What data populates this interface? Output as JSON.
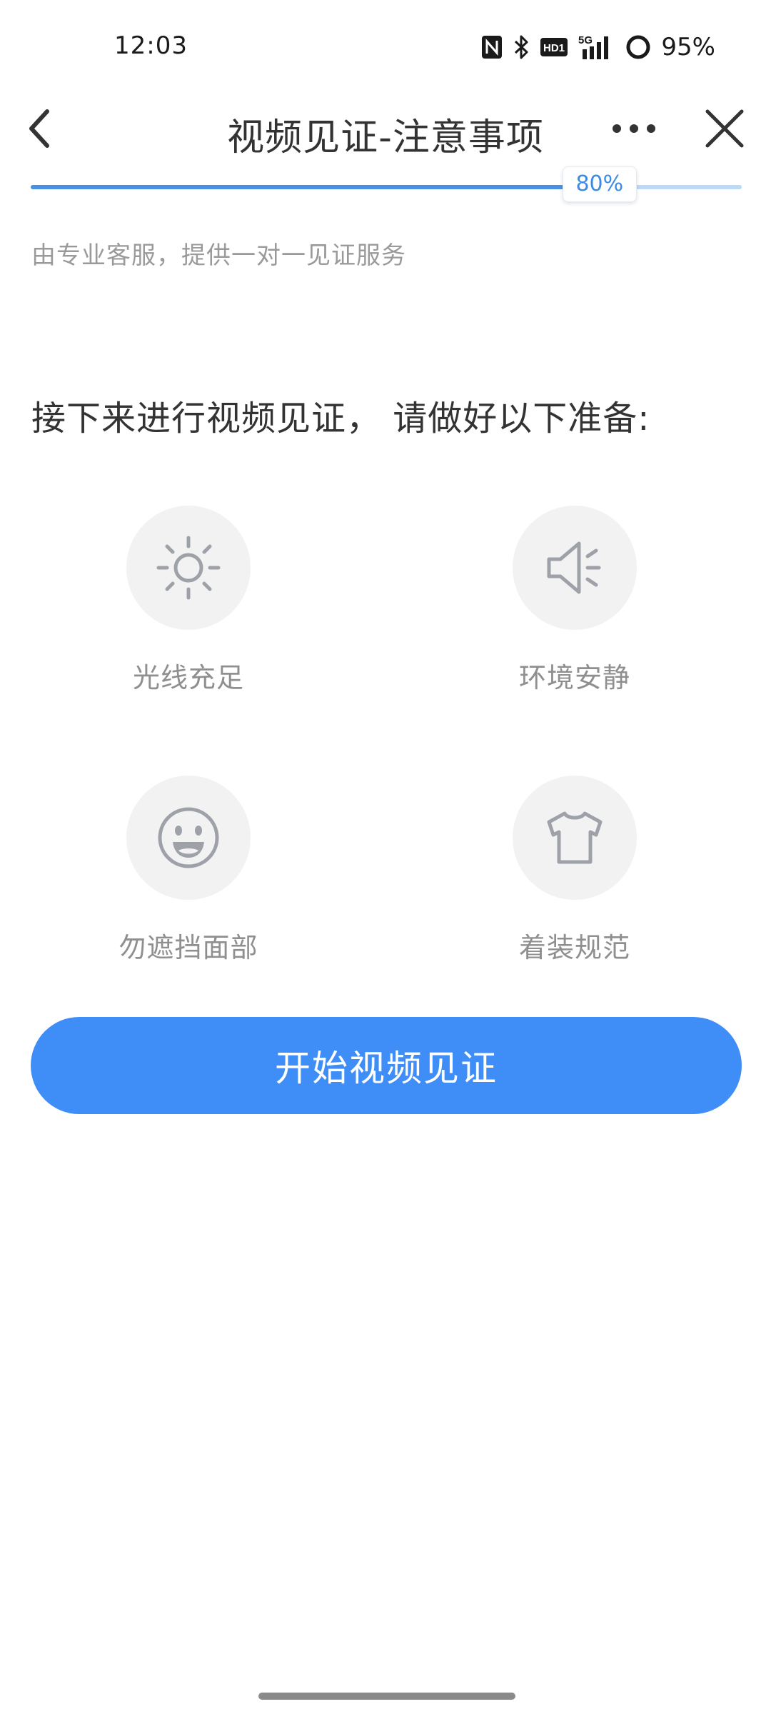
{
  "status_bar": {
    "time": "12:03",
    "icons": [
      "nfc-icon",
      "bluetooth-icon",
      "hd-icon",
      "5g-signal-icon",
      "battery-icon"
    ],
    "hd_label": "HD1",
    "network_label": "5G",
    "battery": "95%",
    "battery_level": 0.95
  },
  "header": {
    "title": "视频见证-注意事项",
    "back_icon": "chevron-left-icon",
    "more_icon": "more-dots-icon",
    "close_icon": "close-icon"
  },
  "progress": {
    "value": 0.8,
    "label": "80%"
  },
  "subtitle": "由专业客服，提供一对一见证服务",
  "prompt": "接下来进行视频见证， 请做好以下准备:",
  "tips": [
    {
      "icon": "sun-icon",
      "label": "光线充足"
    },
    {
      "icon": "speaker-icon",
      "label": "环境安静"
    },
    {
      "icon": "smile-face-icon",
      "label": "勿遮挡面部"
    },
    {
      "icon": "tshirt-icon",
      "label": "着装规范"
    }
  ],
  "start_button": "开始视频见证",
  "colors": {
    "accent": "#3f8ef7",
    "progress_fill": "#4a90e2",
    "progress_track": "#bcd9f7",
    "title_text": "#333333",
    "muted_text": "#9a9a9a",
    "icon_bg": "#f2f2f3",
    "icon_stroke": "#9ea2a8"
  }
}
